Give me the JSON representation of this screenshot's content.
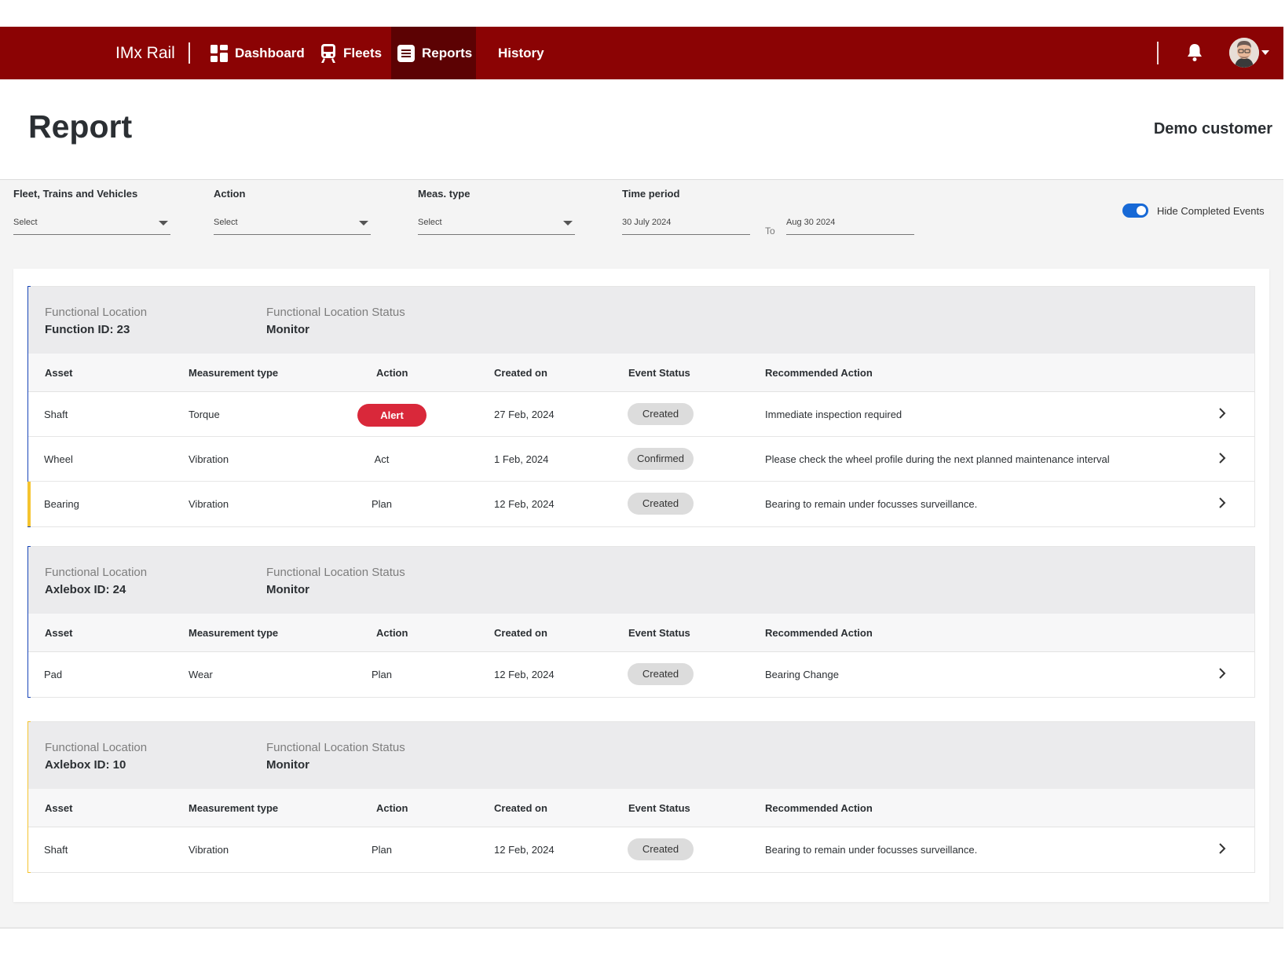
{
  "nav": {
    "brand": "IMx Rail",
    "items": [
      {
        "label": "Dashboard",
        "icon": "dashboard-icon"
      },
      {
        "label": "Fleets",
        "icon": "train-icon"
      },
      {
        "label": "Reports",
        "icon": "report-icon",
        "active": true
      },
      {
        "label": "History"
      }
    ],
    "colors": {
      "bar": "#8b0304",
      "active": "#5c0203"
    }
  },
  "header": {
    "title": "Report",
    "customer": "Demo customer"
  },
  "filters": {
    "fleet": {
      "label": "Fleet, Trains and Vehicles",
      "value": "Select"
    },
    "action": {
      "label": "Action",
      "value": "Select"
    },
    "meas_type": {
      "label": "Meas. type",
      "value": "Select"
    },
    "time_period": {
      "label": "Time period",
      "from": "30 July 2024",
      "to_label": "To",
      "to": "Aug 30 2024"
    },
    "hide_completed": {
      "label": "Hide Completed Events",
      "enabled": true
    }
  },
  "columns": {
    "asset": "Asset",
    "measurement_type": "Measurement type",
    "action": "Action",
    "created_on": "Created on",
    "event_status": "Event Status",
    "recommended_action": "Recommended Action"
  },
  "groups": [
    {
      "location_label": "Functional Location",
      "location": "Function ID: 23",
      "status_label": "Functional Location Status",
      "status": "Monitor",
      "accent": "#1846b8",
      "rows": [
        {
          "asset": "Shaft",
          "measurement_type": "Torque",
          "action": "Alert",
          "created_on": "27 Feb, 2024",
          "event_status": "Created",
          "recommended_action": "Immediate inspection required"
        },
        {
          "asset": "Wheel",
          "measurement_type": "Vibration",
          "action": "Act",
          "created_on": "1 Feb, 2024",
          "event_status": "Confirmed",
          "recommended_action": "Please check the wheel profile during the next planned maintenance interval"
        },
        {
          "asset": "Bearing",
          "measurement_type": "Vibration",
          "action": "Plan",
          "created_on": "12 Feb, 2024",
          "event_status": "Created",
          "recommended_action": "Bearing to remain under  focusses surveillance.",
          "accent": "#f5c430"
        }
      ]
    },
    {
      "location_label": "Functional Location",
      "location": "Axlebox ID: 24",
      "status_label": "Functional Location Status",
      "status": "Monitor",
      "accent": "#1846b8",
      "rows": [
        {
          "asset": "Pad",
          "measurement_type": "Wear",
          "action": "Plan",
          "created_on": "12 Feb, 2024",
          "event_status": "Created",
          "recommended_action": "Bearing Change"
        }
      ]
    },
    {
      "location_label": "Functional Location",
      "location": "Axlebox ID: 10",
      "status_label": "Functional Location Status",
      "status": "Monitor",
      "accent": "#f5c430",
      "rows": [
        {
          "asset": "Shaft",
          "measurement_type": "Vibration",
          "action": "Plan",
          "created_on": "12 Feb, 2024",
          "event_status": "Created",
          "recommended_action": "Bearing to remain under  focusses surveillance."
        }
      ]
    }
  ]
}
